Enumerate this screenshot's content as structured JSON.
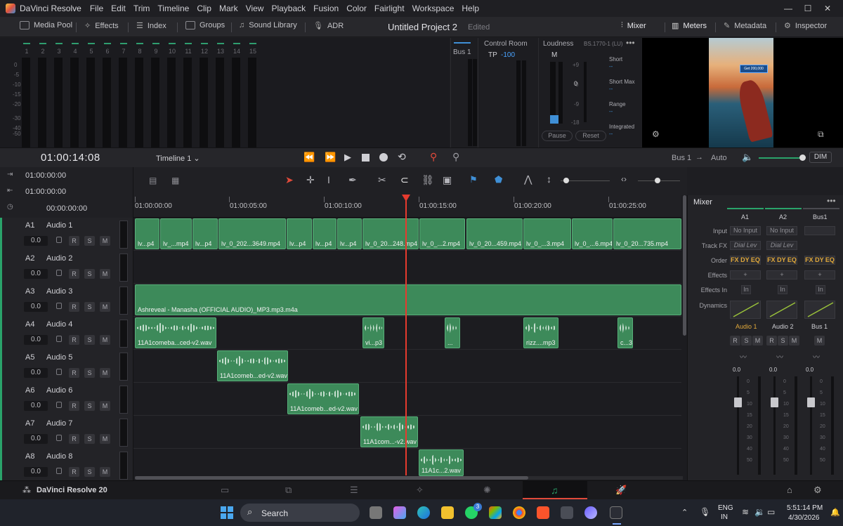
{
  "app": {
    "name": "DaVinci Resolve",
    "menus": [
      "File",
      "Edit",
      "Trim",
      "Timeline",
      "Clip",
      "Mark",
      "View",
      "Playback",
      "Fusion",
      "Color",
      "Fairlight",
      "Workspace",
      "Help"
    ]
  },
  "toolbar": {
    "media_pool": "Media Pool",
    "effects": "Effects",
    "index": "Index",
    "groups": "Groups",
    "sound_library": "Sound Library",
    "adr": "ADR",
    "project_title": "Untitled Project 2",
    "edited": "Edited",
    "mixer": "Mixer",
    "meters": "Meters",
    "metadata": "Metadata",
    "inspector": "Inspector"
  },
  "meters": {
    "channels": [
      "1",
      "2",
      "3",
      "4",
      "5",
      "6",
      "7",
      "8",
      "9",
      "10",
      "11",
      "12",
      "13",
      "14",
      "15"
    ],
    "scale": [
      "0",
      "-5",
      "-10",
      "-15",
      "-20",
      "-30",
      "-40",
      "-50"
    ],
    "bus_label": "Bus 1"
  },
  "control_room": {
    "title": "Control Room",
    "tp_label": "TP",
    "tp_value": "-100"
  },
  "loudness": {
    "title": "Loudness",
    "standard": "BS.1770-1 (LU)",
    "m_label": "M",
    "m_scale_values": [
      "+9",
      "0",
      "-9",
      "-18"
    ],
    "center_value": "0",
    "short": "Short",
    "short_max": "Short Max",
    "range": "Range",
    "integrated": "Integrated",
    "dash": "--",
    "pause": "Pause",
    "reset": "Reset"
  },
  "viewer": {
    "overlay_text": "Get 200,000"
  },
  "transport": {
    "timecode": "01:00:14:08",
    "timeline_name": "Timeline 1",
    "bus": "Bus 1",
    "arrow": "→",
    "auto": "Auto",
    "dim": "DIM"
  },
  "timeline": {
    "tc_rows": [
      "01:00:00:00",
      "01:00:00:00",
      "00:00:00:00"
    ],
    "ruler": [
      "01:00:00:00",
      "01:00:05:00",
      "01:00:10:00",
      "01:00:15:00",
      "01:00:20:00",
      "01:00:25:00"
    ],
    "tracks": [
      {
        "id": "A1",
        "name": "Audio 1",
        "vol": "0.0"
      },
      {
        "id": "A2",
        "name": "Audio 2",
        "vol": "0.0"
      },
      {
        "id": "A3",
        "name": "Audio 3",
        "vol": "0.0"
      },
      {
        "id": "A4",
        "name": "Audio 4",
        "vol": "0.0"
      },
      {
        "id": "A5",
        "name": "Audio 5",
        "vol": "0.0"
      },
      {
        "id": "A6",
        "name": "Audio 6",
        "vol": "0.0"
      },
      {
        "id": "A7",
        "name": "Audio 7",
        "vol": "0.0"
      },
      {
        "id": "A8",
        "name": "Audio 8",
        "vol": "0.0"
      }
    ],
    "btn_r": "R",
    "btn_s": "S",
    "btn_m": "M",
    "a1_clips": [
      "lv...p4",
      "lv_...mp4",
      "lv...p4",
      "lv_0_202...3649.mp4",
      "lv...p4",
      "lv...p4",
      "lv...p4",
      "lv_0_20...248.mp4",
      "lv_0_...2.mp4",
      "lv_0_20...459.mp4",
      "lv_0_...3.mp4",
      "lv_0_...6.mp4",
      "lv_0_20...735.mp4"
    ],
    "a3_clip": "Ashreveal - Manasha (OFFICIAL AUDIO)_MP3.mp3.m4a",
    "a4_clips": [
      "11A1comeba...ced-v2.wav",
      "vi...p3",
      "...",
      "rizz....mp3",
      "c...3"
    ],
    "a5_clip": "11A1comeb...ed-v2.wav",
    "a6_clip": "11A1comeb...ed-v2.wav",
    "a7_clip": "11A1com...-v2.wav",
    "a8_clip": "11A1c...2.wav"
  },
  "mixer": {
    "title": "Mixer",
    "columns": [
      "A1",
      "A2",
      "Bus1"
    ],
    "rows": {
      "input": "Input",
      "track_fx": "Track FX",
      "order": "Order",
      "effects": "Effects",
      "effects_in": "Effects In",
      "dynamics": "Dynamics"
    },
    "no_input": "No Input",
    "dial_lev": "Dial Lev",
    "order_value": "FX DY EQ",
    "plus": "+",
    "in": "In",
    "strips": [
      "Audio 1",
      "Audio 2",
      "Bus 1"
    ],
    "fader_value": "0.0",
    "fader_scale": [
      "0",
      "5",
      "10",
      "15",
      "20",
      "30",
      "40",
      "50"
    ]
  },
  "pagebar": {
    "brand": "DaVinci Resolve 20"
  },
  "taskbar": {
    "search": "Search",
    "lang1": "ENG",
    "lang2": "IN",
    "time": "5:51:14 PM",
    "date": "4/30/2026",
    "badge": "3"
  }
}
